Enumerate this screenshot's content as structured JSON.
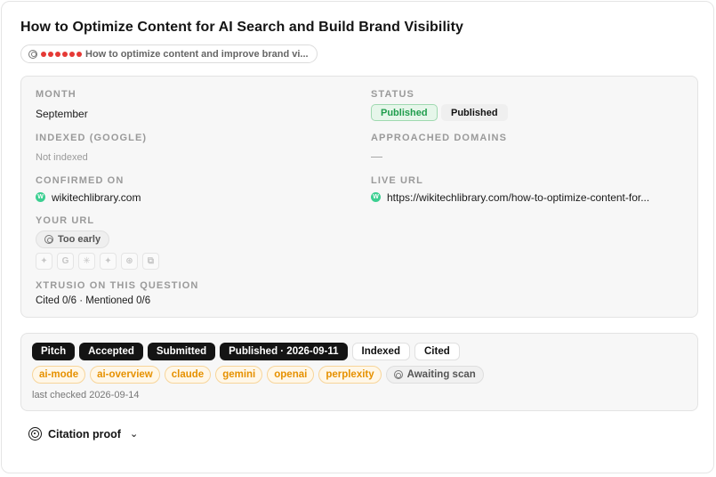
{
  "title": "How to Optimize Content for AI Search and Build Brand Visibility",
  "query_chip": {
    "text": "How to optimize content and improve brand vi..."
  },
  "details": {
    "month_label": "MONTH",
    "month_value": "September",
    "status_label": "STATUS",
    "status_primary": "Published",
    "status_secondary": "Published",
    "indexed_label": "INDEXED (GOOGLE)",
    "indexed_value": "Not indexed",
    "approached_label": "APPROACHED DOMAINS",
    "approached_value": "—",
    "confirmed_label": "CONFIRMED ON",
    "confirmed_value": "wikitechlibrary.com",
    "live_url_label": "LIVE URL",
    "live_url_value": "https://wikitechlibrary.com/how-to-optimize-content-for...",
    "your_url_label": "YOUR URL",
    "too_early": "Too early",
    "engines": [
      "sparkle-icon",
      "google-icon",
      "asterisk-icon",
      "gemini-icon",
      "openai-icon",
      "perplexity-icon"
    ],
    "xtrusio_label": "XTRUSIO ON THIS QUESTION",
    "xtrusio_value": "Cited 0/6 · Mentioned 0/6"
  },
  "pipeline": {
    "steps": [
      "Pitch",
      "Accepted",
      "Submitted",
      "Published · 2026-09-11",
      "Indexed",
      "Cited"
    ],
    "engines": [
      "ai-mode",
      "ai-overview",
      "claude",
      "gemini",
      "openai",
      "perplexity"
    ],
    "scan_label": "Awaiting scan",
    "last_checked": "last checked 2026-09-14"
  },
  "citation": {
    "label": "Citation proof"
  },
  "colors": {
    "accent_dark": "#141414",
    "published_green": "#1f9d4c",
    "engine_orange": "#e69100",
    "dot_red": "#e53935",
    "wp_green": "#3ccf91"
  }
}
